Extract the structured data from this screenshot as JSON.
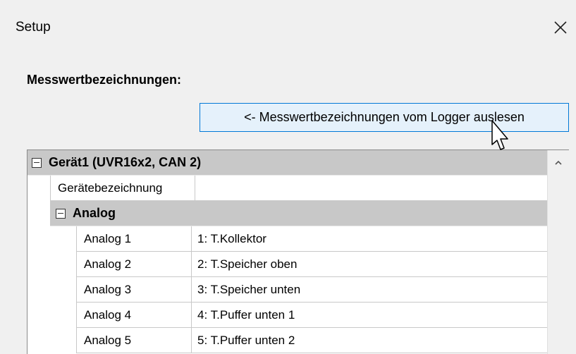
{
  "window": {
    "title": "Setup",
    "close_icon": "close-icon"
  },
  "section": {
    "label": "Messwertbezeichnungen:"
  },
  "read_button": {
    "label": "<- Messwertbezeichnungen vom Logger auslesen"
  },
  "tree": {
    "device": {
      "label": "Gerät1 (UVR16x2, CAN 2)",
      "name_key": "Gerätebezeichnung",
      "name_value": ""
    },
    "analog_group": {
      "label": "Analog",
      "rows": [
        {
          "key": "Analog 1",
          "value": "1: T.Kollektor"
        },
        {
          "key": "Analog 2",
          "value": "2: T.Speicher oben"
        },
        {
          "key": "Analog 3",
          "value": "3: T.Speicher unten"
        },
        {
          "key": "Analog 4",
          "value": "4: T.Puffer unten 1"
        },
        {
          "key": "Analog 5",
          "value": "5: T.Puffer unten 2"
        }
      ]
    }
  },
  "colors": {
    "button_border": "#0078d7",
    "button_fill": "#e5f1fb",
    "group_header": "#c8c8c8"
  }
}
